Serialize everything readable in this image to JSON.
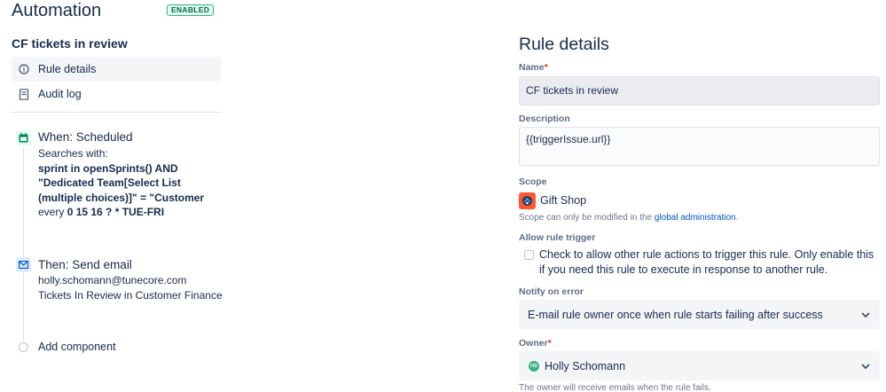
{
  "header": {
    "title": "Automation",
    "status_badge": "ENABLED"
  },
  "sidebar": {
    "rule_name": "CF tickets in review",
    "nav": [
      {
        "label": "Rule details",
        "icon": "info-icon",
        "active": true
      },
      {
        "label": "Audit log",
        "icon": "audit-log-icon",
        "active": false
      }
    ]
  },
  "components": {
    "trigger": {
      "icon": "calendar-icon",
      "title": "When: Scheduled",
      "searches_prefix": "Searches with:",
      "jql": "sprint in openSprints() AND \"Dedicated Team[Select List (multiple choices)]\" = \"Customer",
      "every_prefix": "every",
      "cron": "0 15 16 ? * TUE-FRI"
    },
    "action": {
      "icon": "envelope-icon",
      "title": "Then: Send email",
      "to": "holly.schomann@tunecore.com",
      "subject": "Tickets In Review in Customer Finance"
    },
    "add_label": "Add component"
  },
  "details": {
    "title": "Rule details",
    "name_label": "Name",
    "name_value": "CF tickets in review",
    "description_label": "Description",
    "description_value": "{{triggerIssue.url}}",
    "scope_label": "Scope",
    "scope_value": "Gift Shop",
    "scope_note_prefix": "Scope can only be modified in the",
    "scope_note_link": "global administration",
    "scope_note_suffix": ".",
    "allow_trigger_label": "Allow rule trigger",
    "allow_trigger_text": "Check to allow other rule actions to trigger this rule. Only enable this if you need this rule to execute in response to another rule.",
    "allow_trigger_checked": false,
    "notify_label": "Notify on error",
    "notify_value": "E-mail rule owner once when rule starts failing after success",
    "owner_label": "Owner",
    "owner_initials": "HS",
    "owner_value": "Holly Schomann",
    "owner_note": "The owner will receive emails when the rule fails."
  },
  "colors": {
    "text": "#172b4d",
    "subtle": "#5e6c84",
    "link": "#0052cc",
    "required": "#de350b",
    "enabled_green": "#006644",
    "avatar_green": "#36b37e",
    "scope_orange": "#ff5630"
  }
}
